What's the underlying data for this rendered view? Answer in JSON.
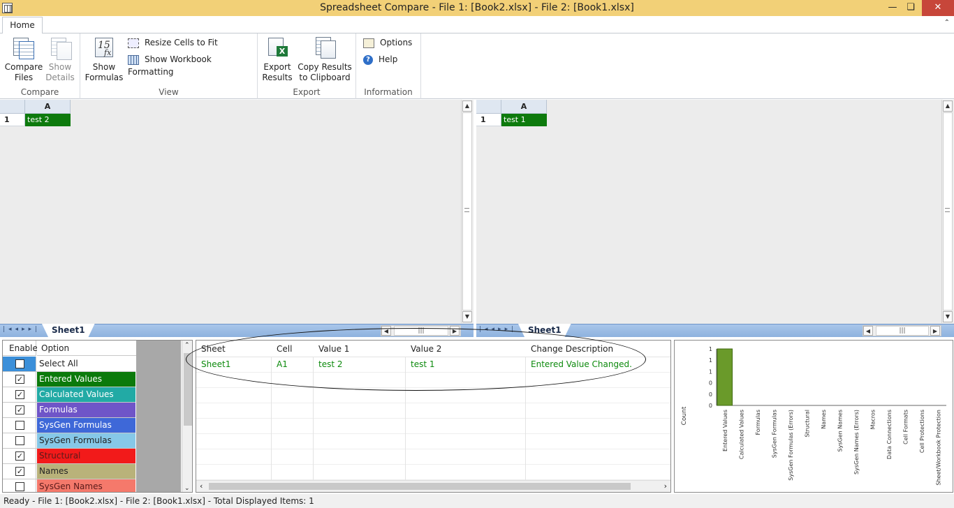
{
  "window": {
    "title": "Spreadsheet Compare - File 1: [Book2.xlsx] - File 2: [Book1.xlsx]",
    "minimize": "—",
    "maximize": "❏",
    "close": "✕"
  },
  "ribbon": {
    "tab_home": "Home",
    "groups": {
      "compare": "Compare",
      "view": "View",
      "export": "Export",
      "information": "Information"
    },
    "compare_files": [
      "Compare",
      "Files"
    ],
    "show_details": [
      "Show",
      "Details"
    ],
    "show_formulas": [
      "Show",
      "Formulas"
    ],
    "resize_cells": "Resize Cells to Fit",
    "show_workbook_formatting": "Show Workbook Formatting",
    "export_results": [
      "Export",
      "Results"
    ],
    "copy_results": [
      "Copy Results",
      "to Clipboard"
    ],
    "options": "Options",
    "help": "Help"
  },
  "left_grid": {
    "col": "A",
    "row": "1",
    "cell": "test 2",
    "sheet_tab": "Sheet1"
  },
  "right_grid": {
    "col": "A",
    "row": "1",
    "cell": "test 1",
    "sheet_tab": "Sheet1"
  },
  "options_panel": {
    "hdr_enable": "Enable",
    "hdr_option": "Option",
    "items": [
      {
        "label": "Select All",
        "checked": false,
        "color": "#ffffff",
        "text": "#222222",
        "chk_bg": "#3b8fd9"
      },
      {
        "label": "Entered Values",
        "checked": true,
        "color": "#0b7a0b",
        "text": "#ffffff"
      },
      {
        "label": "Calculated Values",
        "checked": true,
        "color": "#22aaa5",
        "text": "#ffffff"
      },
      {
        "label": "Formulas",
        "checked": true,
        "color": "#6f55c8",
        "text": "#ffffff"
      },
      {
        "label": "SysGen Formulas",
        "checked": false,
        "color": "#3e68d8",
        "text": "#ffffff"
      },
      {
        "label": "SysGen Formulas Errors",
        "checked": false,
        "color": "#86c8e8",
        "text": "#222222"
      },
      {
        "label": "Structural",
        "checked": true,
        "color": "#f21a1a",
        "text": "#5a1a1a"
      },
      {
        "label": "Names",
        "checked": true,
        "color": "#b9b27a",
        "text": "#222222"
      },
      {
        "label": "SysGen Names",
        "checked": false,
        "color": "#f5796b",
        "text": "#5a1a1a"
      }
    ]
  },
  "results": {
    "headers": [
      "Sheet",
      "Cell",
      "Value 1",
      "Value 2",
      "Change Description"
    ],
    "rows": [
      [
        "Sheet1",
        "A1",
        "test 2",
        "test 1",
        "Entered Value Changed."
      ]
    ]
  },
  "chart_data": {
    "type": "bar",
    "title": "",
    "xlabel": "",
    "ylabel": "Count",
    "y_tick_labels": [
      "1",
      "1",
      "1",
      "0",
      "0",
      "0"
    ],
    "ylim": [
      0,
      1
    ],
    "grid": false,
    "categories": [
      "Entered Values",
      "Calculated Values",
      "Formulas",
      "SysGen Formulas",
      "SysGen Formulas (Errors)",
      "Structural",
      "Names",
      "SysGen Names",
      "SysGen Names (Errors)",
      "Macros",
      "Data Connections",
      "Cell Formats",
      "Cell Protections",
      "Sheet/Workbook Protection"
    ],
    "values": [
      1,
      0,
      0,
      0,
      0,
      0,
      0,
      0,
      0,
      0,
      0,
      0,
      0,
      0
    ],
    "bar_color": "#6a9a2a"
  },
  "status": "Ready - File 1: [Book2.xlsx] - File 2: [Book1.xlsx] - Total Displayed Items: 1"
}
